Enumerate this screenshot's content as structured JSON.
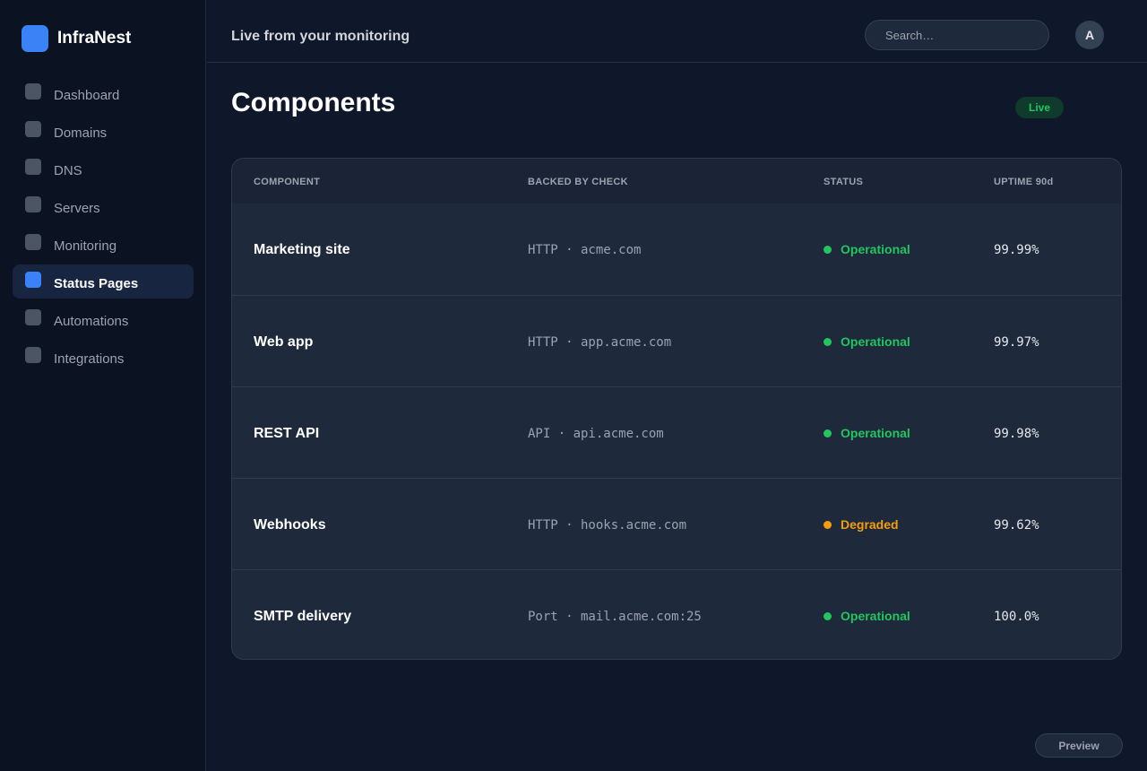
{
  "app": {
    "name": "InfraNest"
  },
  "sidebar": {
    "items": [
      {
        "label": "Dashboard",
        "active": false
      },
      {
        "label": "Domains",
        "active": false
      },
      {
        "label": "DNS",
        "active": false
      },
      {
        "label": "Servers",
        "active": false
      },
      {
        "label": "Monitoring",
        "active": false
      },
      {
        "label": "Status Pages",
        "active": true
      },
      {
        "label": "Automations",
        "active": false
      },
      {
        "label": "Integrations",
        "active": false
      }
    ]
  },
  "topbar": {
    "title": "Live from your monitoring",
    "search_placeholder": "Search…",
    "avatar_initial": "A"
  },
  "page": {
    "title": "Components",
    "badge": "Live"
  },
  "table": {
    "headers": {
      "component": "COMPONENT",
      "check": "BACKED BY CHECK",
      "status": "STATUS",
      "uptime": "UPTIME 90d"
    },
    "rows": [
      {
        "name": "Marketing site",
        "check": "HTTP · acme.com",
        "status": "Operational",
        "uptime": "99.99%"
      },
      {
        "name": "Web app",
        "check": "HTTP · app.acme.com",
        "status": "Operational",
        "uptime": "99.97%"
      },
      {
        "name": "REST API",
        "check": "API · api.acme.com",
        "status": "Operational",
        "uptime": "99.98%"
      },
      {
        "name": "Webhooks",
        "check": "HTTP · hooks.acme.com",
        "status": "Degraded",
        "uptime": "99.62%"
      },
      {
        "name": "SMTP delivery",
        "check": "Port · mail.acme.com:25",
        "status": "Operational",
        "uptime": "100.0%"
      }
    ]
  },
  "footer": {
    "preview_label": "Preview"
  },
  "colors": {
    "accent": "#3b82f6",
    "operational": "#22c55e",
    "degraded": "#f59e0b"
  }
}
